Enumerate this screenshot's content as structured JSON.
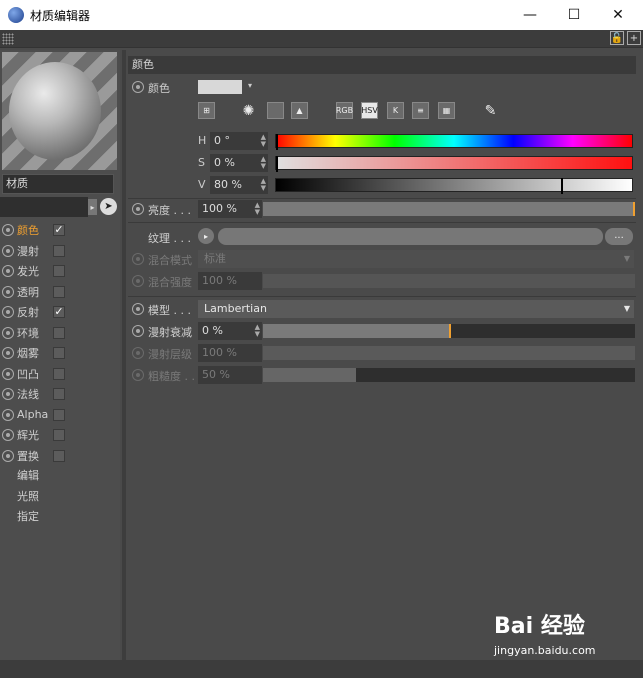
{
  "window": {
    "title": "材质编辑器",
    "minimize": "—",
    "maximize": "☐",
    "close": "✕"
  },
  "toolbar": {
    "lock": "🔓",
    "add": "+"
  },
  "left": {
    "material_name": "材质",
    "channels": [
      {
        "label": "颜色",
        "checked": "✓",
        "active": true
      },
      {
        "label": "漫射",
        "checked": ""
      },
      {
        "label": "发光",
        "checked": ""
      },
      {
        "label": "透明",
        "checked": ""
      },
      {
        "label": "反射",
        "checked": "✓"
      },
      {
        "label": "环境",
        "checked": ""
      },
      {
        "label": "烟雾",
        "checked": ""
      },
      {
        "label": "凹凸",
        "checked": ""
      },
      {
        "label": "法线",
        "checked": ""
      },
      {
        "label": "Alpha",
        "checked": ""
      },
      {
        "label": "辉光",
        "checked": ""
      },
      {
        "label": "置换",
        "checked": ""
      }
    ],
    "extra": [
      "编辑",
      "光照",
      "指定"
    ]
  },
  "color": {
    "section_title": "颜色",
    "color_label": "颜色",
    "swatch_color": "#d8d8d8",
    "mode_buttons": [
      "RGB",
      "HSV",
      "K"
    ],
    "h_label": "H",
    "h_value": "0 °",
    "s_label": "S",
    "s_value": "0 %",
    "v_label": "V",
    "v_value": "80 %",
    "v_level": 0.8,
    "brightness_label": "亮度 . . .",
    "brightness_value": "100 %",
    "brightness_level": 1.0,
    "texture_label": "纹理 . . .",
    "texture_more": "...",
    "blend_mode_label": "混合模式",
    "blend_mode_value": "标准",
    "blend_strength_label": "混合强度",
    "blend_strength_value": "100 %",
    "model_label": "模型 . . .",
    "model_value": "Lambertian",
    "diffuse_falloff_label": "漫射衰减",
    "diffuse_falloff_value": "0 %",
    "diffuse_falloff_level": 0.5,
    "diffuse_level_label": "漫射层级",
    "diffuse_level_value": "100 %",
    "roughness_label": "粗糙度 . .",
    "roughness_value": "50 %",
    "roughness_level": 0.25
  },
  "watermark": {
    "logo": "Bai 经验",
    "url": "jingyan.baidu.com"
  }
}
